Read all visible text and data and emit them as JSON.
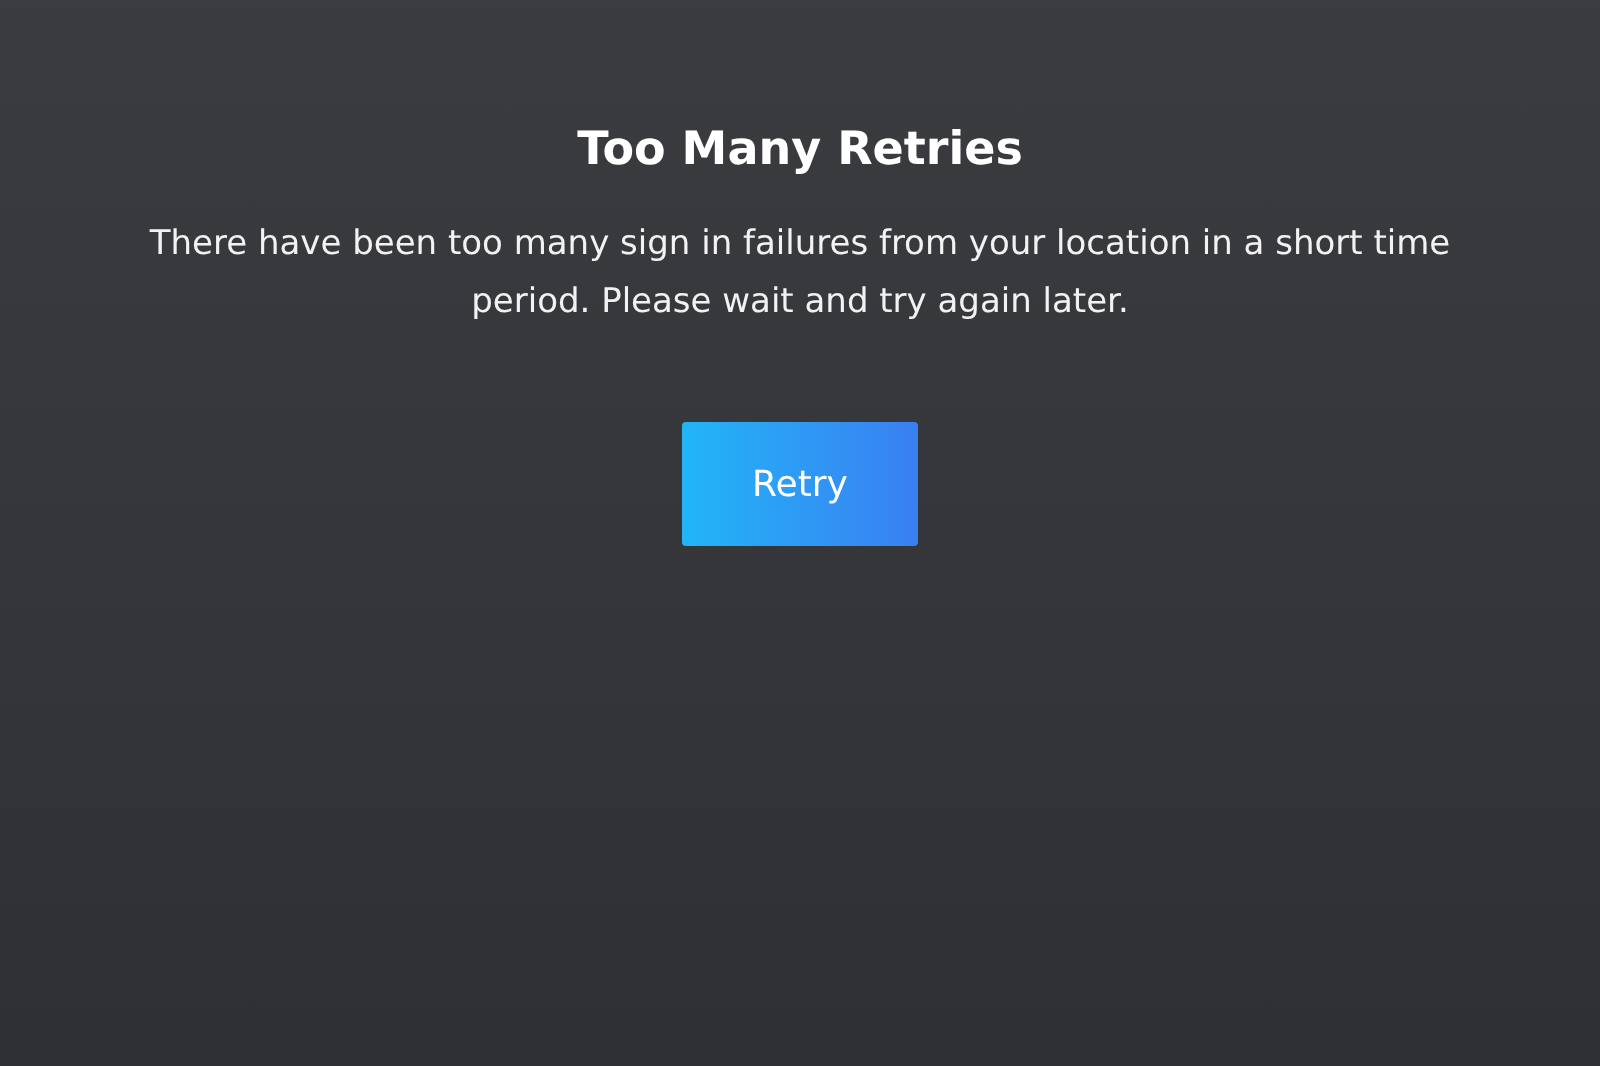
{
  "title": "Too Many Retries",
  "message": "There have been too many sign in failures from your location in a short time period. Please wait and try again later.",
  "buttons": [
    {
      "label": "Retry"
    }
  ]
}
